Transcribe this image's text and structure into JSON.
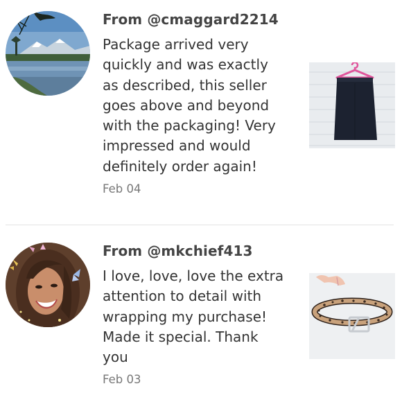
{
  "reviews": [
    {
      "from_prefix": "From",
      "username": "@cmaggard2214",
      "lines": [
        "Package arrived very",
        "quickly and was exactly",
        "as described, this seller",
        "goes above and beyond",
        "with the packaging! Very",
        "impressed and would",
        "definitely order again!"
      ],
      "date": "Feb 04",
      "avatar_icon": "mountain-lake-photo",
      "thumbnail_icon": "skirt-on-hanger-photo"
    },
    {
      "from_prefix": "From",
      "username": "@mkchief413",
      "lines": [
        "I love, love, love the extra",
        "attention to detail with",
        "wrapping my purchase!",
        "Made it special. Thank",
        "you"
      ],
      "date": "Feb 03",
      "avatar_icon": "smiling-woman-photo",
      "thumbnail_icon": "leopard-belt-photo"
    }
  ],
  "colors": {
    "username_text": "#444444",
    "body_text": "#333333",
    "date_text": "#777777",
    "divider": "#e3e3e3"
  }
}
